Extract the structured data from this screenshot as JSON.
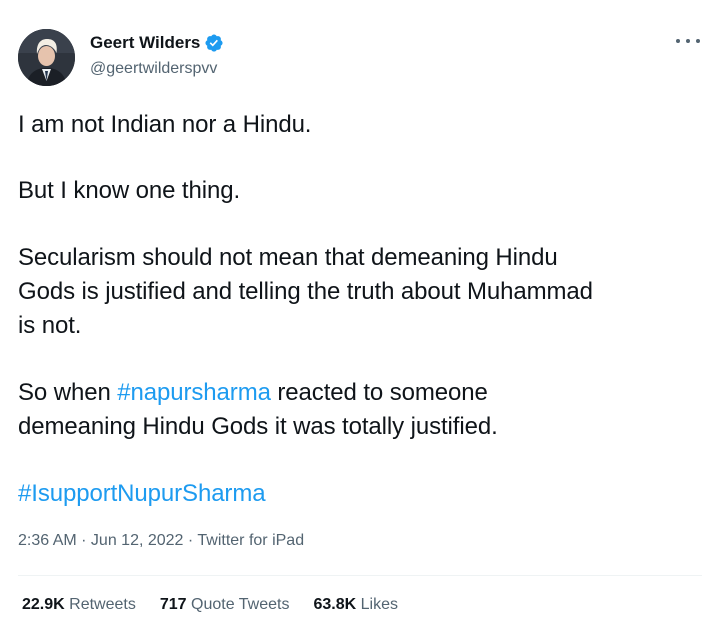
{
  "author": {
    "name": "Geert Wilders",
    "handle": "@geertwilderspvv",
    "verified": true
  },
  "tweet": {
    "line1": "I am not Indian nor a Hindu.",
    "line2": "But I know one thing.",
    "line3a": "Secularism should not mean that demeaning Hindu",
    "line3b": "Gods is justified and telling the truth about Muhammad",
    "line3c": "is not.",
    "line4_pre": "So when ",
    "line4_hashtag": "#napursharma",
    "line4_post": " reacted to someone",
    "line4b": "demeaning Hindu Gods it was totally justified.",
    "hashtag_final": "#IsupportNupurSharma"
  },
  "meta": {
    "time": "2:36 AM",
    "sep1": " · ",
    "date": "Jun 12, 2022",
    "sep2": " · ",
    "source": "Twitter for iPad"
  },
  "stats": {
    "retweets_count": "22.9K",
    "retweets_label": "Retweets",
    "quotes_count": "717",
    "quotes_label": "Quote Tweets",
    "likes_count": "63.8K",
    "likes_label": "Likes"
  },
  "colors": {
    "link": "#1d9bf0",
    "text": "#0f1419",
    "secondary": "#536471"
  }
}
